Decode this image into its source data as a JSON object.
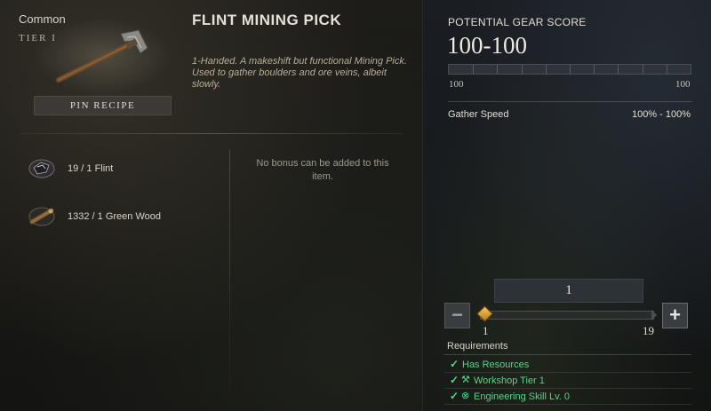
{
  "item": {
    "rarity": "Common",
    "tier": "TIER I",
    "name": "FLINT MINING PICK",
    "description": "1-Handed. A makeshift but functional Mining Pick. Used to gather boulders and ore veins, albeit slowly.",
    "pin_button": "PIN RECIPE",
    "image_icon": "mining-pick-icon"
  },
  "ingredients": [
    {
      "icon": "flint-icon",
      "text": "19 / 1 Flint"
    },
    {
      "icon": "green-wood-icon",
      "text": "1332 / 1 Green Wood"
    }
  ],
  "bonus_note": "No bonus can be added to this item.",
  "gear_score": {
    "title": "POTENTIAL GEAR SCORE",
    "value": "100-100",
    "min": "100",
    "max": "100"
  },
  "stats": [
    {
      "name": "Gather Speed",
      "value": "100% - 100%"
    }
  ],
  "quantity": {
    "value": "1",
    "min": "1",
    "max": "19",
    "minus_icon": "minus-icon",
    "plus_icon": "plus-icon"
  },
  "requirements": {
    "title": "Requirements",
    "items": [
      {
        "text": "Has Resources",
        "icon": "check-icon"
      },
      {
        "text": "Workshop Tier 1",
        "icon": "workshop-icon"
      },
      {
        "text": "Engineering Skill Lv. 0",
        "icon": "engineering-icon"
      }
    ]
  },
  "colors": {
    "met_requirement": "#5fd28a",
    "slider_handle": "#f6c75a"
  }
}
